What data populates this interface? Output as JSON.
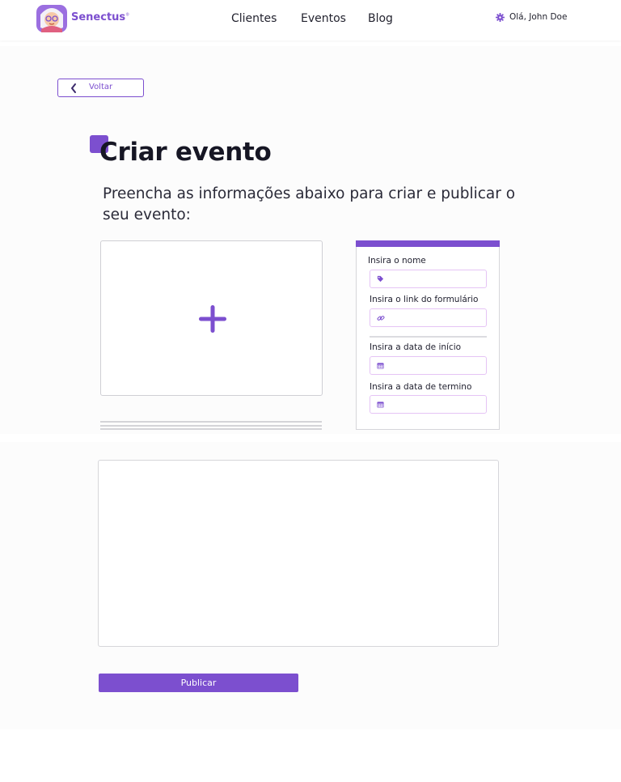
{
  "header": {
    "brand": "Senectus",
    "brand_mark": "®",
    "nav": [
      "Clientes",
      "Eventos",
      "Blog"
    ],
    "user_greeting": "Olá, John Doe",
    "user_icon": "gear-icon"
  },
  "page": {
    "back_label": "Voltar",
    "title": "Criar evento",
    "subtitle": "Preencha as informações abaixo para criar e publicar o seu evento:"
  },
  "image_upload": {
    "icon": "plus-icon"
  },
  "form": {
    "name_label": "Insira o nome",
    "name_icon": "tag-icon",
    "name_value": "",
    "link_label": "Insira o link do formulário",
    "link_icon": "link-icon",
    "link_value": "",
    "start_label": "Insira a data de início",
    "start_icon": "calendar-icon",
    "start_value": "",
    "end_label": "Insira a data de termino",
    "end_icon": "calendar-icon",
    "end_value": ""
  },
  "description": {
    "value": ""
  },
  "actions": {
    "publish_label": "Publicar"
  },
  "colors": {
    "accent": "#7c4fcf",
    "field_border": "#e5c4f5",
    "card_border": "#d6d6da",
    "section_bg": "#fcfcfc"
  }
}
